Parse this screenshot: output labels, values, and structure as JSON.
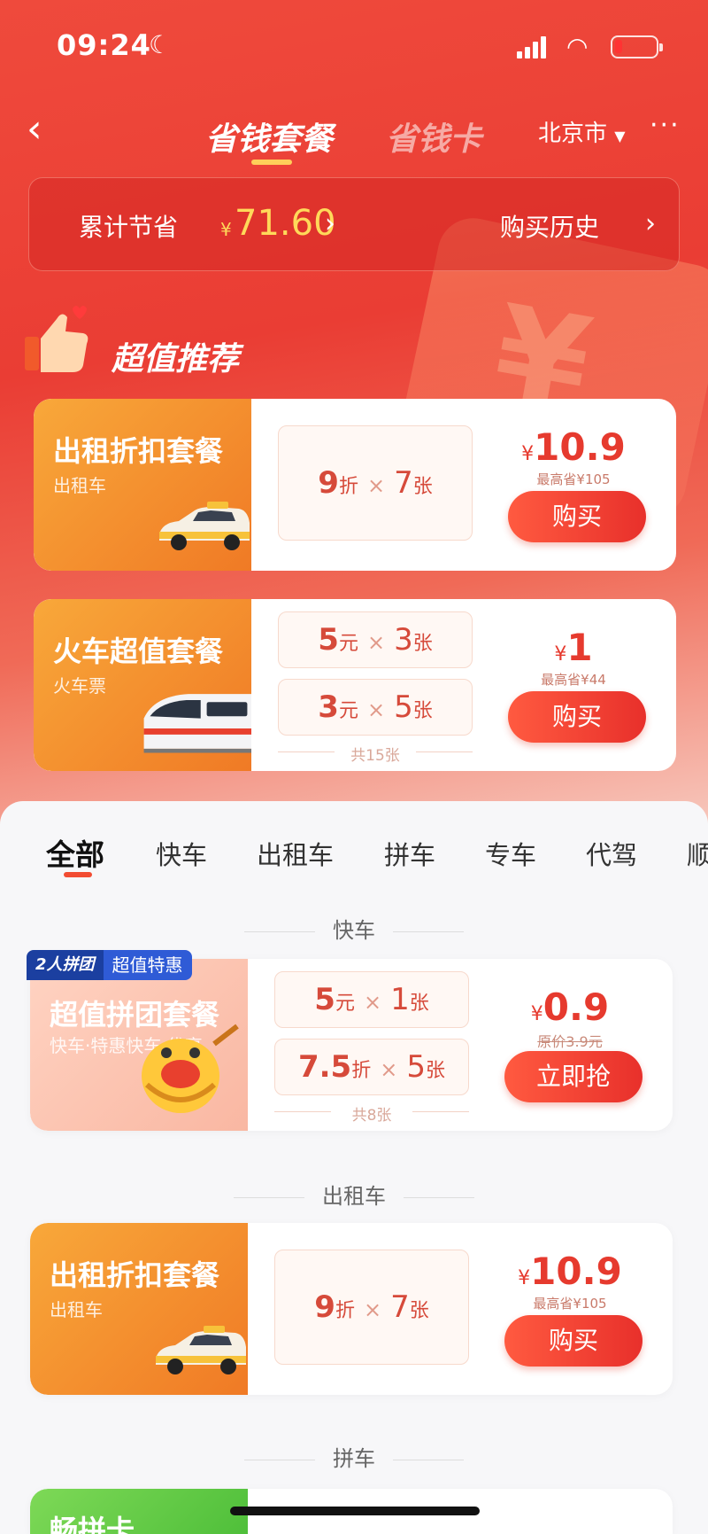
{
  "status": {
    "time": "09:24",
    "colors": {
      "battery_low": "#ff3333"
    }
  },
  "nav": {
    "back_icon": "chevron-left-icon",
    "tabs": [
      {
        "label": "省钱套餐"
      },
      {
        "label": "省钱卡"
      }
    ],
    "city": "北京市",
    "more_icon": "more-dots-icon"
  },
  "savings": {
    "label": "累计节省",
    "currency": "¥",
    "amount": "71.60",
    "history": "购买历史"
  },
  "recommend": {
    "title": "超值推荐"
  },
  "rec_cards": [
    {
      "title": "出租折扣套餐",
      "subtitle": "出租车",
      "vehicle": "taxi",
      "coupons": [
        {
          "value": "9",
          "unit": "折",
          "count": "7",
          "count_unit": "张"
        }
      ],
      "currency": "¥",
      "price": "10.9",
      "note": "最高省¥105",
      "button": "购买"
    },
    {
      "title": "火车超值套餐",
      "subtitle": "火车票",
      "vehicle": "train",
      "coupons": [
        {
          "value": "5",
          "unit": "元",
          "count": "3",
          "count_unit": "张"
        },
        {
          "value": "3",
          "unit": "元",
          "count": "5",
          "count_unit": "张"
        }
      ],
      "total": "共15张",
      "currency": "¥",
      "price": "1",
      "note": "最高省¥44",
      "button": "购买"
    }
  ],
  "categories": [
    "全部",
    "快车",
    "出租车",
    "拼车",
    "专车",
    "代驾",
    "顺"
  ],
  "sections": [
    {
      "label": "快车",
      "card": {
        "badge_left": "2人拼团",
        "badge_right": "超值特惠",
        "title": "超值拼团套餐",
        "subtitle": "快车·特惠快车·优享",
        "coupons": [
          {
            "value": "5",
            "unit": "元",
            "count": "1",
            "count_unit": "张"
          },
          {
            "value": "7.5",
            "unit": "折",
            "count": "5",
            "count_unit": "张"
          }
        ],
        "total": "共8张",
        "currency": "¥",
        "price": "0.9",
        "note": "原价3.9元",
        "button": "立即抢"
      }
    },
    {
      "label": "出租车",
      "card": {
        "title": "出租折扣套餐",
        "subtitle": "出租车",
        "coupons": [
          {
            "value": "9",
            "unit": "折",
            "count": "7",
            "count_unit": "张"
          }
        ],
        "currency": "¥",
        "price": "10.9",
        "note": "最高省¥105",
        "button": "购买"
      }
    },
    {
      "label": "拼车",
      "card": {
        "title": "畅拼卡"
      }
    }
  ],
  "colors": {
    "brand_red": "#e63a2e",
    "gold": "#ffd95a",
    "orange": "#f07a25"
  }
}
